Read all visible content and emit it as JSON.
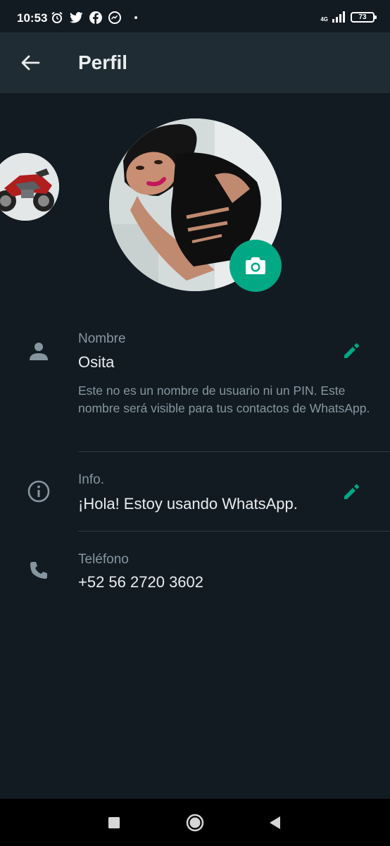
{
  "status_bar": {
    "time": "10:53",
    "network": "4G",
    "battery": "73",
    "icons": [
      "alarm-icon",
      "twitter-icon",
      "facebook-icon",
      "messenger-icon",
      "dot-icon",
      "signal-icon",
      "battery-icon"
    ]
  },
  "app_bar": {
    "title": "Perfil",
    "back_icon": "arrow-back-icon"
  },
  "profile": {
    "camera_icon": "camera-icon"
  },
  "fields": {
    "name": {
      "label": "Nombre",
      "value": "Osita",
      "helper": "Este no es un nombre de usuario ni un PIN. Este nombre será visible para tus contactos de WhatsApp.",
      "icon": "person-icon",
      "edit_icon": "pencil-icon"
    },
    "info": {
      "label": "Info.",
      "value": "¡Hola! Estoy usando WhatsApp.",
      "icon": "info-icon",
      "edit_icon": "pencil-icon"
    },
    "phone": {
      "label": "Teléfono",
      "value": "+52 56 2720 3602",
      "icon": "phone-icon"
    }
  },
  "nav_bar": {
    "icons": [
      "square-recents-icon",
      "circle-home-icon",
      "triangle-back-icon"
    ]
  },
  "colors": {
    "background": "#121b22",
    "app_bar": "#202c33",
    "accent": "#00a884",
    "primary_text": "#e9edef",
    "secondary_text": "#8696a0"
  }
}
